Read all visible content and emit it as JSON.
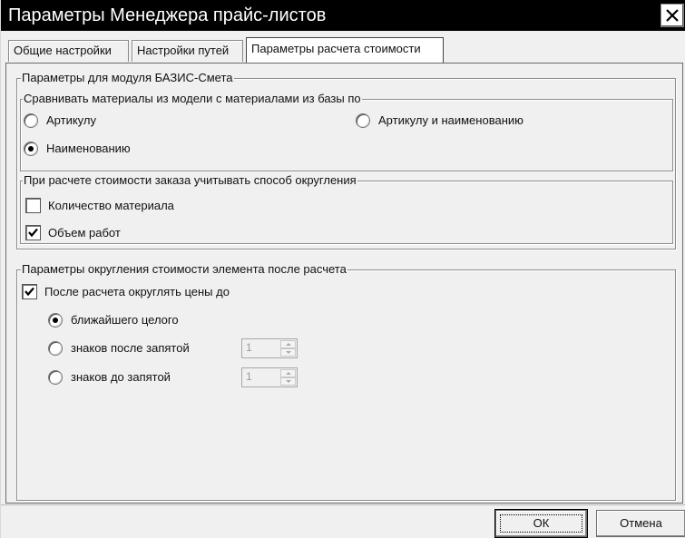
{
  "window": {
    "title": "Параметры Менеджера прайс-листов"
  },
  "tabs": [
    {
      "label": "Общие настройки"
    },
    {
      "label": "Настройки путей"
    },
    {
      "label": "Параметры расчета стоимости"
    }
  ],
  "bazis_group": {
    "title": "Параметры для модуля БАЗИС-Смета",
    "compare": {
      "title": "Сравнивать материалы из модели с материалами из базы по",
      "options": [
        {
          "label": "Артикулу",
          "selected": false
        },
        {
          "label": "Артикулу и наименованию",
          "selected": false
        },
        {
          "label": "Наименованию",
          "selected": true
        }
      ]
    },
    "rounding_method": {
      "title": "При расчете стоимости заказа учитывать способ округления",
      "options": [
        {
          "label": "Количество материала",
          "checked": false
        },
        {
          "label": "Объем работ",
          "checked": true
        }
      ]
    }
  },
  "rounding_group": {
    "title": "Параметры округления стоимости элемента после расчета",
    "round_prices": {
      "label": "После расчета округлять цены до",
      "checked": true
    },
    "options": [
      {
        "label": "ближайшего целого",
        "selected": true
      },
      {
        "label": "знаков после запятой",
        "selected": false,
        "spin_value": "1"
      },
      {
        "label": "знаков до запятой",
        "selected": false,
        "spin_value": "1"
      }
    ]
  },
  "buttons": {
    "ok": "ОК",
    "cancel": "Отмена"
  }
}
